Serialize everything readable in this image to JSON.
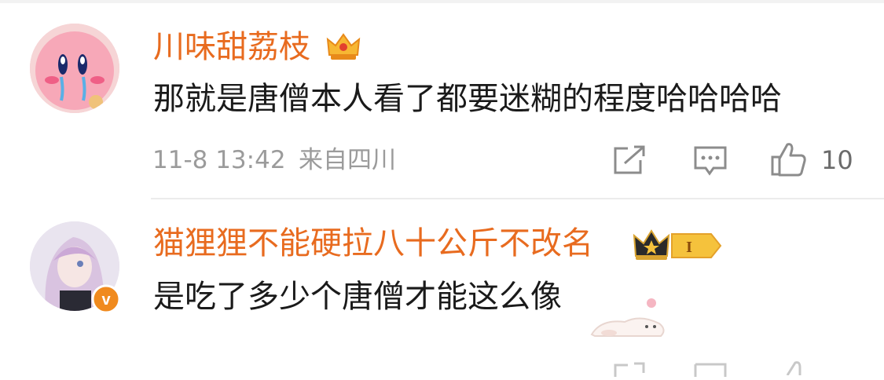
{
  "comments": [
    {
      "username": "川味甜荔枝",
      "text": "那就是唐僧本人看了都要迷糊的程度哈哈哈哈",
      "time": "11-8 13:42",
      "location": "来自四川",
      "likes": "10",
      "badge": "crown-badge"
    },
    {
      "username": "猫狸狸不能硬拉八十公斤不改名",
      "text": "是吃了多少个唐僧才能这么像",
      "badge_level": "I",
      "badge": "crown-level-badge",
      "verified": "v"
    }
  ],
  "colors": {
    "username": "#e86b1f",
    "text": "#1a1a1a",
    "meta": "#9b9b9b",
    "icon": "#8c8c8c"
  }
}
